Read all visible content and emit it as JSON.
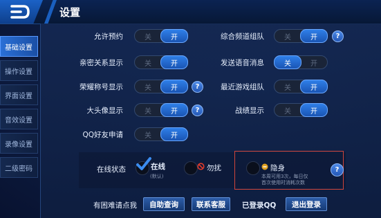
{
  "header": {
    "title": "设置"
  },
  "sidebar": {
    "items": [
      {
        "label": "基础设置",
        "active": true
      },
      {
        "label": "操作设置",
        "active": false
      },
      {
        "label": "界面设置",
        "active": false
      },
      {
        "label": "音效设置",
        "active": false
      },
      {
        "label": "录像设置",
        "active": false
      },
      {
        "label": "二级密码",
        "active": false
      }
    ]
  },
  "toggle": {
    "off_label": "关",
    "on_label": "开"
  },
  "settings": {
    "allow_reserve": {
      "label": "允许预约",
      "value": "开"
    },
    "intimacy_display": {
      "label": "亲密关系显示",
      "value": "开"
    },
    "honor_title_display": {
      "label": "荣耀称号显示",
      "value": "开"
    },
    "avatar_display": {
      "label": "大头像显示",
      "value": "开"
    },
    "qq_friend_request": {
      "label": "QQ好友申请",
      "value": "开"
    },
    "channel_team": {
      "label": "综合频道组队",
      "value": "开"
    },
    "voice_message": {
      "label": "发送语音消息",
      "value": "关"
    },
    "recent_game_team": {
      "label": "最近游戏组队",
      "value": "开"
    },
    "battle_record_display": {
      "label": "战绩显示",
      "value": "开"
    }
  },
  "online_status": {
    "label": "在线状态",
    "online": {
      "label": "在线",
      "sub": "(默认)",
      "selected": true
    },
    "dnd": {
      "label": "勿扰",
      "selected": false
    },
    "invisible": {
      "label": "隐身",
      "note_line1": "本周可用3次，每日仅",
      "note_line2": "首次使用时消耗次数",
      "selected": false
    }
  },
  "help_glyph": "?",
  "footer": {
    "help_text": "有困难请点我",
    "self_query": "自助查询",
    "contact_service": "联系客服",
    "logged_in": "已登录QQ",
    "logout": "退出登录"
  },
  "colors": {
    "accent": "#2f7fe8",
    "highlight_box": "#d0453a"
  }
}
